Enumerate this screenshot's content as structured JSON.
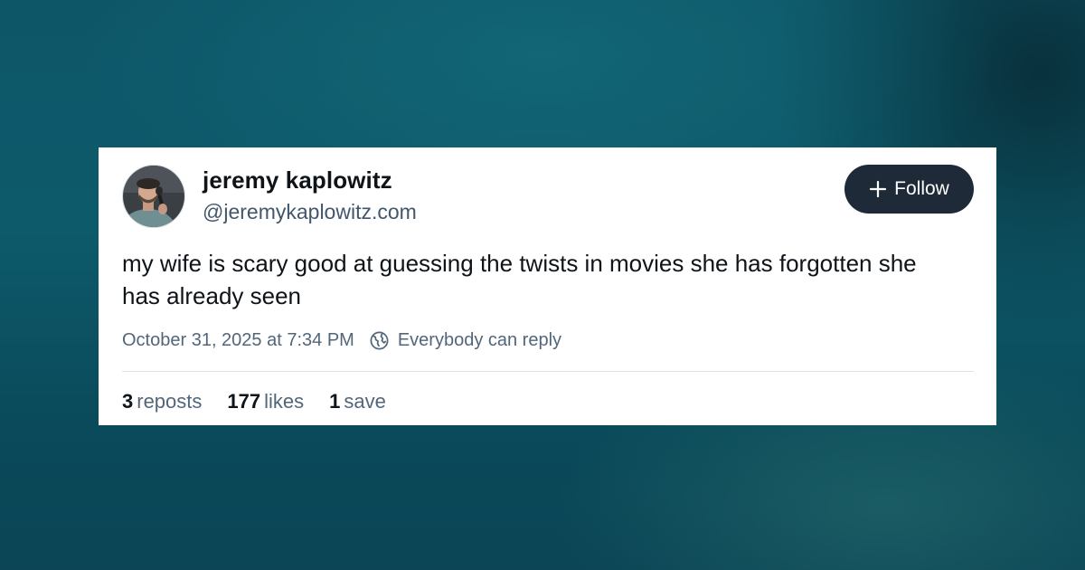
{
  "post": {
    "author": {
      "display_name": "jeremy kaplowitz",
      "handle": "@jeremykaplowitz.com",
      "avatar_icon": "user-photo-microphone"
    },
    "follow_button": {
      "label": "Follow",
      "icon": "plus-icon"
    },
    "text": "my wife is scary good at guessing the twists in movies she has forgotten she has already seen",
    "timestamp": "October 31, 2025 at 7:34 PM",
    "reply_setting": {
      "icon": "globe-icon",
      "label": "Everybody can reply"
    },
    "stats": {
      "reposts_count": "3",
      "reposts_label": "reposts",
      "likes_count": "177",
      "likes_label": "likes",
      "saves_count": "1",
      "saves_label": "save"
    }
  },
  "colors": {
    "background": "#0d5668",
    "card": "#ffffff",
    "follow_button": "#1e2a38",
    "primary_text": "#0f1419",
    "secondary_text": "#52667a"
  }
}
